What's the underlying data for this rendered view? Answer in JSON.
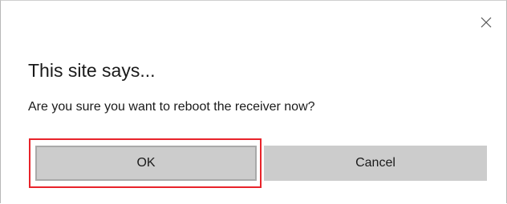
{
  "dialog": {
    "close_icon": "close-icon",
    "title": "This site says...",
    "message": "Are you sure you want to reboot the receiver now?",
    "ok_label": "OK",
    "cancel_label": "Cancel"
  },
  "colors": {
    "button_bg": "#cccccc",
    "focus_border": "#a9a9a9",
    "highlight": "#e8232a",
    "text": "#1a1a1a"
  }
}
